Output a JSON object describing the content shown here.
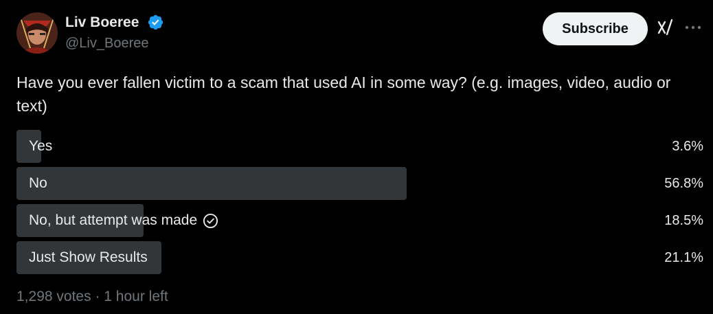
{
  "author": {
    "name": "Liv Boeree",
    "handle": "@Liv_Boeree",
    "verified": true,
    "avatar_icon": "user-avatar"
  },
  "header_actions": {
    "subscribe_label": "Subscribe",
    "grok_icon": "grok-icon",
    "more_icon": "more-horizontal-icon"
  },
  "post": {
    "text": "Have you ever fallen victim to a scam that used AI in some way? (e.g. images, video, audio or text)"
  },
  "poll": {
    "options": [
      {
        "label": "Yes",
        "percent": "3.6%",
        "value": 3.6,
        "selected": false
      },
      {
        "label": "No",
        "percent": "56.8%",
        "value": 56.8,
        "selected": false
      },
      {
        "label": "No, but attempt was made",
        "percent": "18.5%",
        "value": 18.5,
        "selected": true
      },
      {
        "label": "Just Show Results",
        "percent": "21.1%",
        "value": 21.1,
        "selected": false
      }
    ],
    "votes": "1,298 votes",
    "separator": "·",
    "time_left": "1 hour left"
  },
  "colors": {
    "background": "#000000",
    "text_primary": "#e7e9ea",
    "text_secondary": "#71767b",
    "poll_bar": "#333639",
    "verified_blue": "#1d9bf0",
    "button_bg": "#eff3f4"
  }
}
